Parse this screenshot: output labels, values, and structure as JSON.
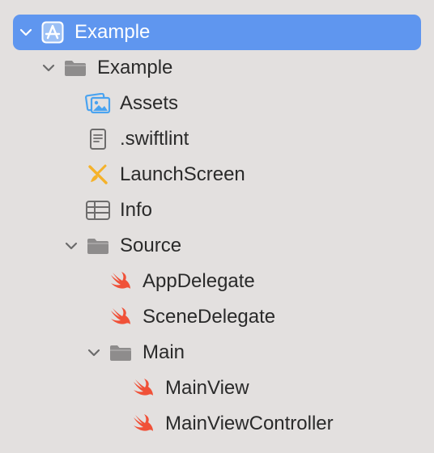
{
  "navigator": {
    "items": [
      {
        "label": "Example",
        "icon": "app-project-icon",
        "expanded": true,
        "selected": true
      },
      {
        "label": "Example",
        "icon": "folder-icon",
        "expanded": true
      },
      {
        "label": "Assets",
        "icon": "asset-catalog-icon"
      },
      {
        "label": ".swiftlint",
        "icon": "text-file-icon"
      },
      {
        "label": "LaunchScreen",
        "icon": "storyboard-icon"
      },
      {
        "label": "Info",
        "icon": "plist-icon"
      },
      {
        "label": "Source",
        "icon": "folder-icon",
        "expanded": true
      },
      {
        "label": "AppDelegate",
        "icon": "swift-file-icon"
      },
      {
        "label": "SceneDelegate",
        "icon": "swift-file-icon"
      },
      {
        "label": "Main",
        "icon": "folder-icon",
        "expanded": true
      },
      {
        "label": "MainView",
        "icon": "swift-file-icon"
      },
      {
        "label": "MainViewController",
        "icon": "swift-file-icon"
      }
    ]
  },
  "colors": {
    "background": "#e3e0df",
    "selection": "#5f96ef",
    "text": "#2a2a2a",
    "swift": "#f05138",
    "folder": "#8e8c8c",
    "asset": "#4aa3f0",
    "storyboard": "#f5b22a"
  }
}
